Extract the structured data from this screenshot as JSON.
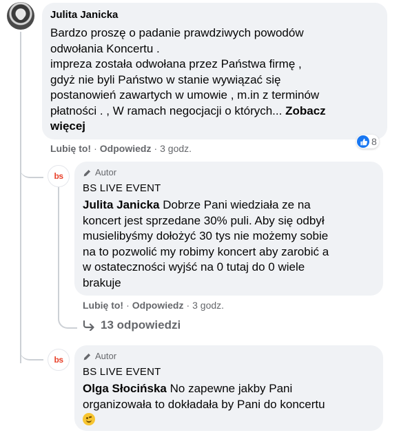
{
  "comment1": {
    "author": "Julita Janicka",
    "lines": [
      "Bardzo proszę o padanie prawdziwych powodów",
      "odwołania Koncertu .",
      "impreza została odwołana przez Państwa firmę ,",
      "gdyż nie byli Państwo w stanie wywiązać się",
      "postanowień zawartych w umowie , m.in z terminów",
      "płatności . , W ramach negocjacji o których..."
    ],
    "see_more_1": "Zobacz",
    "see_more_2": "więcej",
    "like": "Lubię to!",
    "sep1": "·",
    "reply": "Odpowiedz",
    "sep2": "·",
    "time": "3 godz.",
    "reaction_count": "8",
    "reaction_icon": "thumbs-up-icon"
  },
  "reply1": {
    "badge": "Autor",
    "page_name": "BS LIVE EVENT",
    "mention": "Julita Janicka",
    "line1_rest": "Dobrze Pani wiedziała ze na",
    "lines": [
      "koncert jest sprzedane 30% puli. Aby się odbył",
      "musielibyśmy dołożyć 30 tys nie możemy sobie",
      "na to pozwolić my robimy koncert aby zarobić a",
      "w ostateczności wyjść na 0 tutaj do 0 wiele",
      "brakuje"
    ],
    "like": "Lubię to!",
    "sep1": "·",
    "reply": "Odpowiedz",
    "sep2": "·",
    "time": "3 godz."
  },
  "more_replies": {
    "label": "13 odpowiedzi",
    "icon": "reply-arrow-icon"
  },
  "reply2": {
    "badge": "Autor",
    "page_name": "BS LIVE EVENT",
    "mention": "Olga Słocińska",
    "line1_rest": "No zapewne jakby Pani",
    "lines": [
      "organizowała to dokładała by Pani do koncertu"
    ],
    "emoji": "smiling-face-emoji"
  },
  "logo": {
    "text": "bs",
    "brand_color": "#e8412a"
  },
  "colors": {
    "bubble": "#f0f2f5",
    "secondary_text": "#65676b",
    "like_blue": "#1877f2",
    "thread_line": "#ccd0d5"
  }
}
